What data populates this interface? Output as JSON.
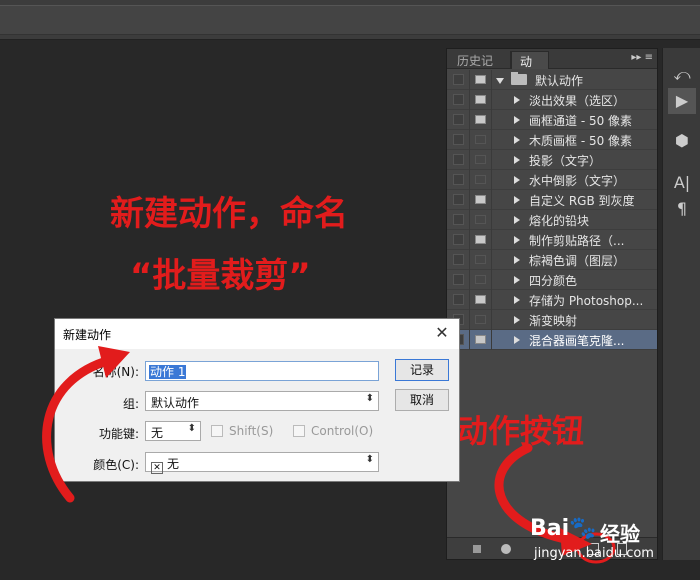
{
  "panel": {
    "tabs": [
      {
        "label": "历史记录"
      },
      {
        "label": "动作"
      }
    ],
    "menu_glyph": "▸▸ ≡",
    "action_set": "默认动作",
    "actions": [
      {
        "label": "淡出效果（选区）",
        "dialog": true
      },
      {
        "label": "画框通道 - 50 像素",
        "dialog": true
      },
      {
        "label": "木质画框 - 50 像素",
        "dialog": false
      },
      {
        "label": "投影（文字）",
        "dialog": false
      },
      {
        "label": "水中倒影（文字）",
        "dialog": false
      },
      {
        "label": "自定义 RGB 到灰度",
        "dialog": true
      },
      {
        "label": "熔化的铅块",
        "dialog": false
      },
      {
        "label": "制作剪贴路径（...",
        "dialog": true
      },
      {
        "label": "棕褐色调（图层）",
        "dialog": false
      },
      {
        "label": "四分颜色",
        "dialog": false
      },
      {
        "label": "存储为 Photoshop...",
        "dialog": true
      },
      {
        "label": "渐变映射",
        "dialog": false
      },
      {
        "label": "混合器画笔克隆...",
        "dialog": true,
        "selected": true
      }
    ]
  },
  "right_strip": {
    "history_icon": "⤺",
    "play_icon": "▶",
    "cube_icon": "⬢",
    "text_icon": "A|",
    "para_icon": "¶"
  },
  "annotations": {
    "line1": "新建动作，命名",
    "line2": "“批量裁剪”",
    "line3": "新建动作按钮",
    "color": "#e21c1c"
  },
  "dialog": {
    "title": "新建动作",
    "close": "✕",
    "name_label": "名称(N):",
    "name_value": "动作 1",
    "set_label": "组:",
    "set_value": "默认动作",
    "fkey_label": "功能键:",
    "fkey_value": "无",
    "shift_label": "Shift(S)",
    "ctrl_label": "Control(O)",
    "color_label": "颜色(C):",
    "color_value": "无",
    "color_x": "✕",
    "record_button": "记录",
    "cancel_button": "取消"
  },
  "watermark": {
    "logo": "Bai",
    "paw": "🐾",
    "jingyan": "经验",
    "url": "jingyan.baidu.com"
  }
}
